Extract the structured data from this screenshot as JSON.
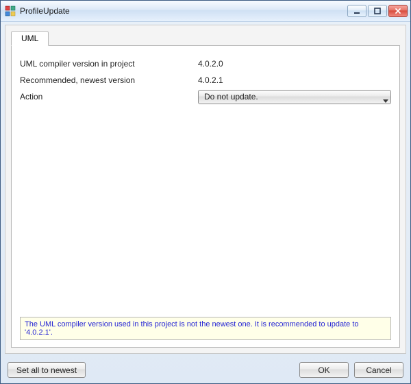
{
  "window": {
    "title": "ProfileUpdate"
  },
  "tabs": [
    {
      "label": "UML"
    }
  ],
  "form": {
    "current_label": "UML compiler version in project",
    "current_value": "4.0.2.0",
    "newest_label": "Recommended, newest version",
    "newest_value": "4.0.2.1",
    "action_label": "Action",
    "action_selected": "Do not update."
  },
  "info_message": "The UML compiler version used in this project is not the newest one. It is recommended to update to '4.0.2.1'.",
  "buttons": {
    "set_all": "Set all to newest",
    "ok": "OK",
    "cancel": "Cancel"
  }
}
